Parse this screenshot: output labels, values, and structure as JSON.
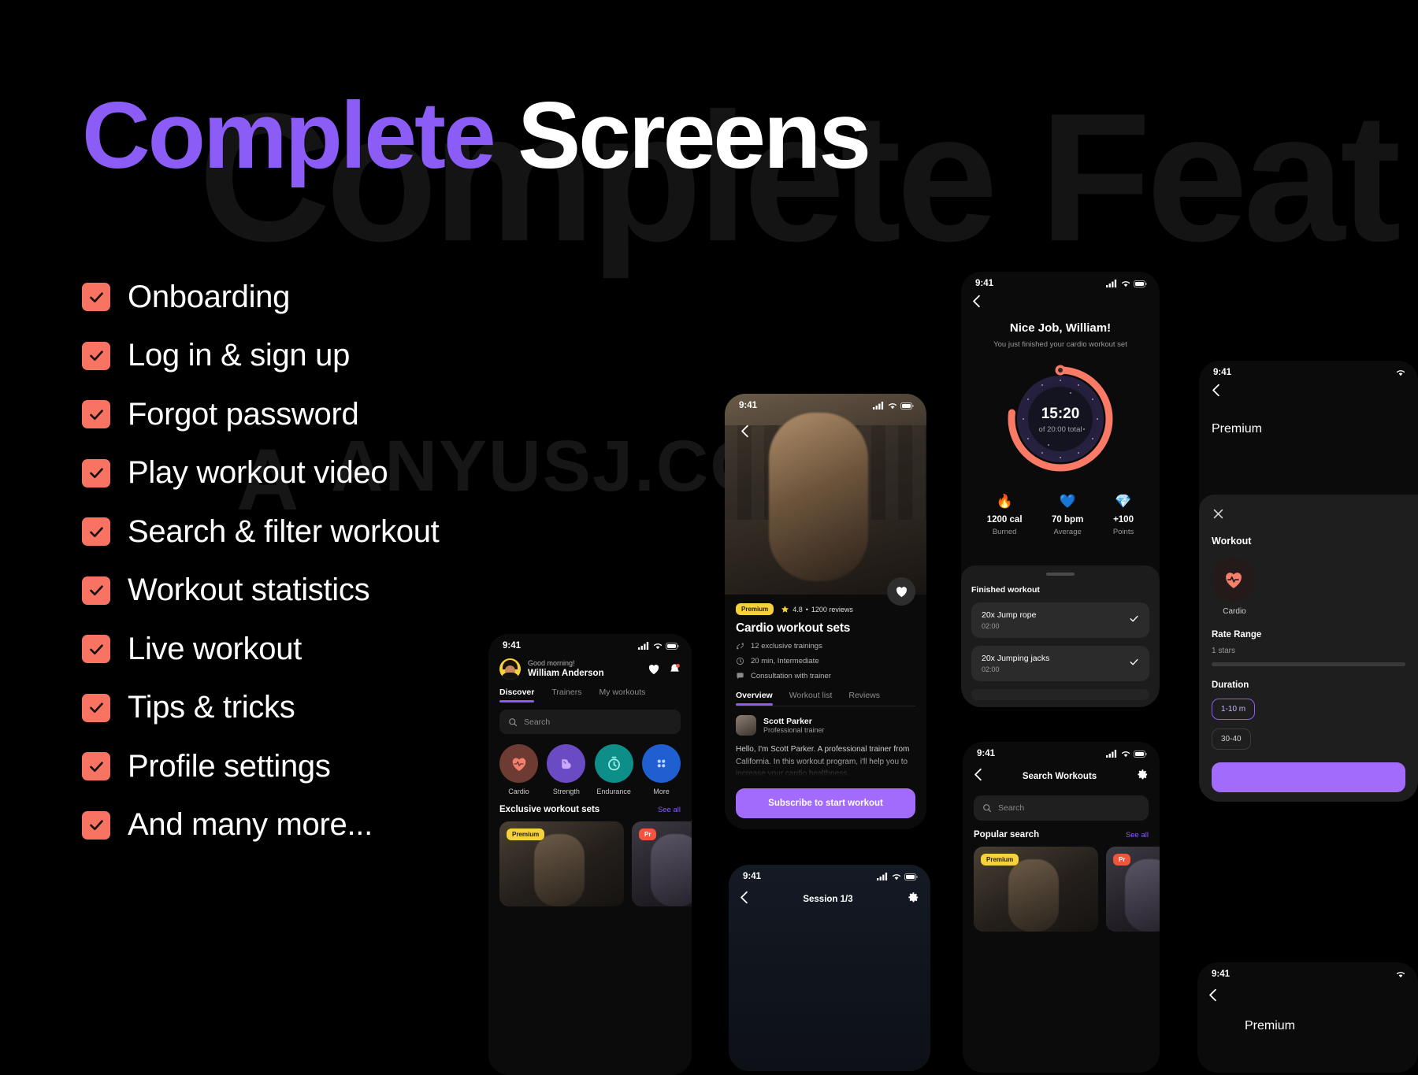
{
  "hero": {
    "ghost_text": "Complete Feat",
    "accent_word": "Complete",
    "plain_word": " Screens",
    "accent_color": "#8B5CF6"
  },
  "watermark": {
    "mark": "A",
    "text": "ANYUSJ.COM",
    "reg": "®"
  },
  "checklist": {
    "check_color": "#F97362",
    "items": [
      {
        "label": "Onboarding"
      },
      {
        "label": "Log in & sign up"
      },
      {
        "label": "Forgot password"
      },
      {
        "label": "Play workout video"
      },
      {
        "label": "Search & filter workout"
      },
      {
        "label": "Workout statistics"
      },
      {
        "label": "Live workout"
      },
      {
        "label": "Tips & tricks"
      },
      {
        "label": "Profile settings"
      },
      {
        "label": "And many more..."
      }
    ]
  },
  "status_bar": {
    "time": "9:41"
  },
  "home_screen": {
    "greeting": "Good morning!",
    "user_name": "William Anderson",
    "tabs": [
      {
        "label": "Discover",
        "active": true
      },
      {
        "label": "Trainers",
        "active": false
      },
      {
        "label": "My workouts",
        "active": false
      }
    ],
    "search_placeholder": "Search",
    "categories": [
      {
        "label": "Cardio",
        "icon": "heart-pulse-icon",
        "bg": "#6E3B33",
        "glyph": "❤"
      },
      {
        "label": "Strength",
        "icon": "bicep-icon",
        "bg": "#6B4BC4",
        "glyph": "💪"
      },
      {
        "label": "Endurance",
        "icon": "stopwatch-icon",
        "bg": "#0E8E88",
        "glyph": "⏱"
      },
      {
        "label": "More",
        "icon": "grid-dots-icon",
        "bg": "#1F5FD0",
        "glyph": "⁙"
      }
    ],
    "section_title": "Exclusive workout sets",
    "see_all": "See all",
    "card_badges": [
      "Premium",
      "Pr"
    ]
  },
  "detail_screen": {
    "badge": "Premium",
    "rating": "4.8",
    "reviews": "1200 reviews",
    "title": "Cardio workout sets",
    "features": [
      {
        "icon": "dumbbell-icon",
        "label": "12 exclusive trainings"
      },
      {
        "icon": "clock-icon",
        "label": "20 min, Intermediate"
      },
      {
        "icon": "chat-icon",
        "label": "Consultation with trainer"
      }
    ],
    "tabs": [
      {
        "label": "Overview",
        "active": true
      },
      {
        "label": "Workout list",
        "active": false
      },
      {
        "label": "Reviews",
        "active": false
      }
    ],
    "trainer_name": "Scott Parker",
    "trainer_role": "Professional trainer",
    "bio": "Hello, I'm Scott Parker. A professional trainer from California. In this workout program, i'll help you to increase your cardio healthness.",
    "cta": "Subscribe to start workout"
  },
  "result_screen": {
    "title": "Nice Job, William!",
    "subtitle": "You just finished your cardio workout set",
    "time_elapsed": "15:20",
    "time_total": "of 20:00 total",
    "progress_percent": 77,
    "ring_color": "#FA7A66",
    "stats": [
      {
        "icon": "flame-icon",
        "glyph": "🔥",
        "value": "1200 cal",
        "label": "Burned"
      },
      {
        "icon": "heart-rate-icon",
        "glyph": "💙",
        "value": "70 bpm",
        "label": "Average"
      },
      {
        "icon": "diamond-icon",
        "glyph": "💎",
        "value": "+100",
        "label": "Points"
      }
    ],
    "sheet_title": "Finished workout",
    "exercises": [
      {
        "name": "20x Jump rope",
        "duration": "02:00",
        "done": true
      },
      {
        "name": "20x Jumping jacks",
        "duration": "02:00",
        "done": true
      }
    ]
  },
  "search_screen": {
    "title": "Search Workouts",
    "search_placeholder": "Search",
    "popular_title": "Popular search",
    "see_all": "See all",
    "card_badges": [
      "Premium",
      "Pr"
    ]
  },
  "session_screen": {
    "title": "Session 1/3"
  },
  "filter_screen": {
    "badge": "Premium",
    "title": "Workout",
    "category_label": "Cardio",
    "rate_label": "Rate Range",
    "rate_value": "1 stars",
    "duration_label": "Duration",
    "chips": [
      "1-10 m",
      "30-40"
    ]
  }
}
